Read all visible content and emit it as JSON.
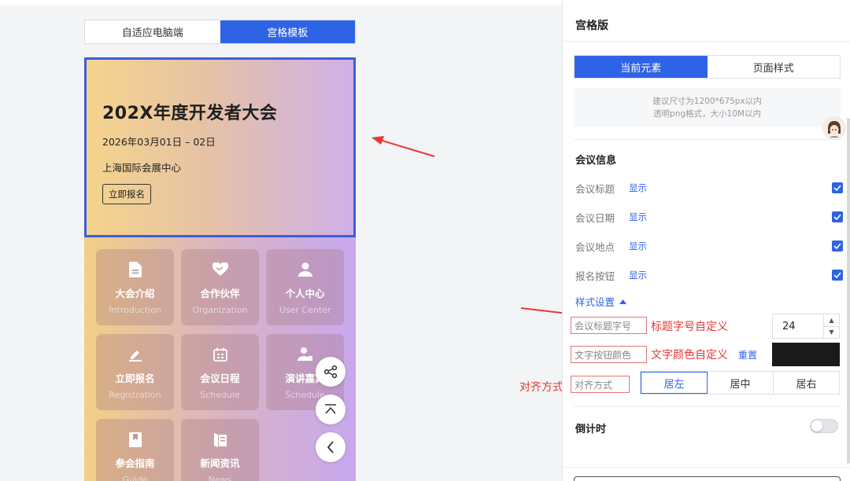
{
  "canvas_tabs": {
    "adaptive": "自适应电脑端",
    "grid": "宫格模板"
  },
  "banner": {
    "title": "202X年度开发者大会",
    "date": "2026年03月01日 – 02日",
    "place": "上海国际会展中心",
    "button": "立即报名"
  },
  "tiles": [
    {
      "name": "大会介绍",
      "en": "Introduction",
      "icon": "document-icon"
    },
    {
      "name": "合作伙伴",
      "en": "Organization",
      "icon": "handshake-heart-icon"
    },
    {
      "name": "个人中心",
      "en": "User Center",
      "icon": "user-icon"
    },
    {
      "name": "立即报名",
      "en": "Registration",
      "icon": "pen-icon"
    },
    {
      "name": "会议日程",
      "en": "Schedule",
      "icon": "calendar-icon"
    },
    {
      "name": "演讲嘉宾",
      "en": "Schedule",
      "icon": "speaker-icon"
    },
    {
      "name": "参会指南",
      "en": "Guide",
      "icon": "bookmark-icon"
    },
    {
      "name": "新闻资讯",
      "en": "News",
      "icon": "news-icon"
    }
  ],
  "annotations": {
    "title_font_size": "标题字号自定义",
    "text_color": "文字颜色自定义",
    "alignment": "对齐方式"
  },
  "panel": {
    "title": "宫格版",
    "seg_current": "当前元素",
    "seg_page": "页面样式",
    "upload_line1": "建议尺寸为1200*675px以内",
    "upload_line2": "透明png格式，大小10M以内",
    "meeting_info": "会议信息",
    "fields": [
      {
        "label": "会议标题",
        "tag": "显示",
        "checked": true
      },
      {
        "label": "会议日期",
        "tag": "显示",
        "checked": true
      },
      {
        "label": "会议地点",
        "tag": "显示",
        "checked": true
      },
      {
        "label": "报名按钮",
        "tag": "显示",
        "checked": true
      }
    ],
    "style_settings": "样式设置",
    "title_font_label": "会议标题字号",
    "title_font_value": "24",
    "button_color_label": "文字按钮颜色",
    "reset": "重置",
    "align_label": "对齐方式",
    "align_options": [
      "居左",
      "居中",
      "居右"
    ],
    "align_selected": "居左",
    "countdown": "倒计时",
    "countdown_on": false
  },
  "colors": {
    "accent": "#2f63e6",
    "annotation_red": "#e53935",
    "button_color": "#1a1a1a"
  }
}
